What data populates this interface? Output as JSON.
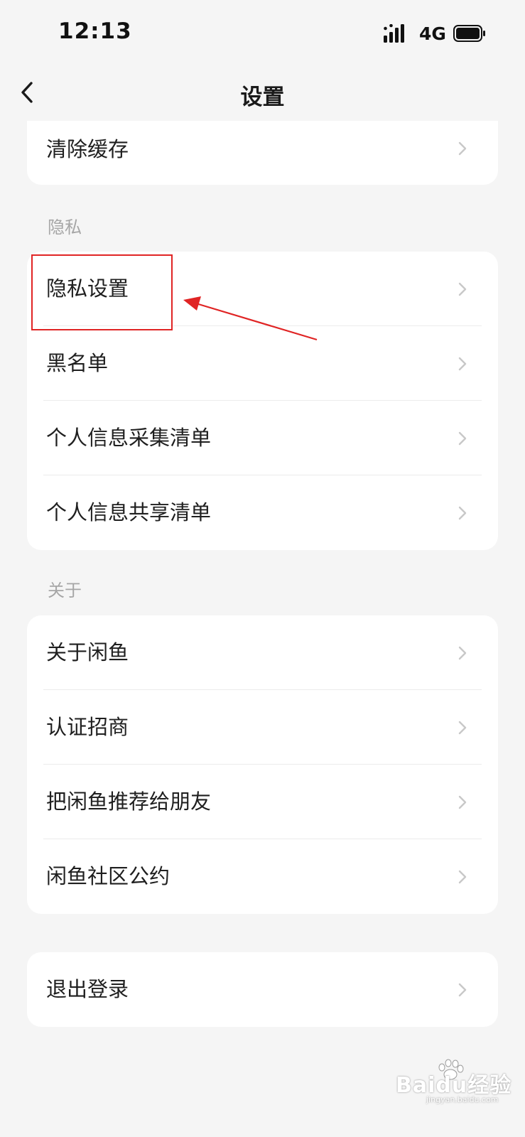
{
  "status_bar": {
    "time": "12:13",
    "network": "4G"
  },
  "nav": {
    "title": "设置"
  },
  "sections": {
    "general": {
      "items": [
        {
          "label": "清除缓存"
        }
      ]
    },
    "privacy": {
      "header": "隐私",
      "items": [
        {
          "label": "隐私设置"
        },
        {
          "label": "黑名单"
        },
        {
          "label": "个人信息采集清单"
        },
        {
          "label": "个人信息共享清单"
        }
      ]
    },
    "about": {
      "header": "关于",
      "items": [
        {
          "label": "关于闲鱼"
        },
        {
          "label": "认证招商"
        },
        {
          "label": "把闲鱼推荐给朋友"
        },
        {
          "label": "闲鱼社区公约"
        }
      ]
    },
    "account": {
      "items": [
        {
          "label": "退出登录"
        }
      ]
    }
  },
  "annotation": {
    "color": "#e02424"
  },
  "watermark": {
    "brand": "Baidu经验",
    "url": "jingyan.baidu.com"
  },
  "colors": {
    "background": "#f5f5f5",
    "card": "#ffffff",
    "section_header": "#a6a6a6",
    "chevron": "#c8c8c8"
  },
  "icons": [
    "back-icon",
    "chevron-right-icon",
    "signal-icon",
    "battery-icon",
    "annotation-arrow"
  ]
}
